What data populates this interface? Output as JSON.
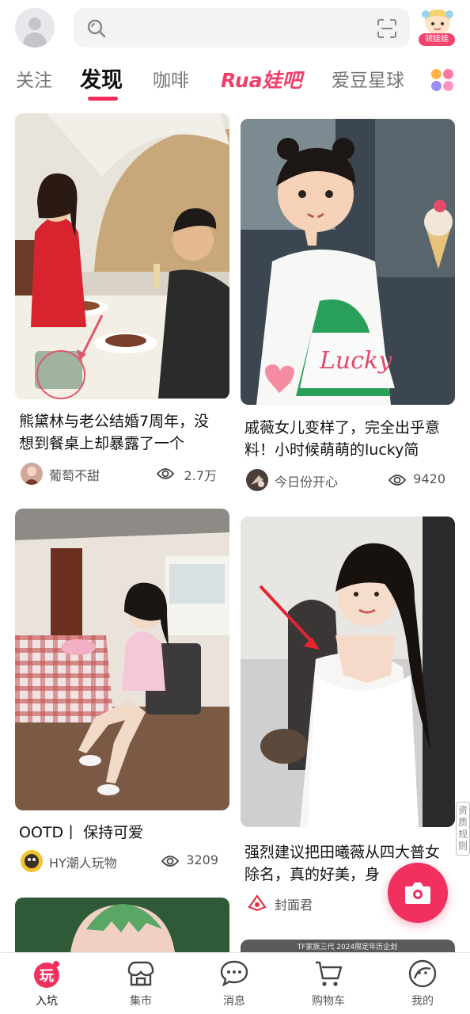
{
  "header": {
    "search_placeholder": "",
    "badge_label": "领娃娃"
  },
  "tabs": [
    "关注",
    "发现",
    "咖啡",
    "Rua娃吧",
    "爱豆星球"
  ],
  "active_tab": "发现",
  "feed": [
    {
      "title": "熊黛林与老公结婚7周年，没想到餐桌上却暴露了一个",
      "author": "葡萄不甜",
      "views": "2.7万"
    },
    {
      "title": "戚薇女儿变样了，完全出乎意料！小时候萌萌的lucky简",
      "author": "今日份开心",
      "views": "9420"
    },
    {
      "title": "OOTD丨 保持可爱",
      "author": "HY潮人玩物",
      "views": "3209"
    },
    {
      "title": "强烈建议把田曦薇从四大普女除名，真的好美，身",
      "author": "封面君",
      "views": ""
    }
  ],
  "side_note": "资质规则",
  "partial_banner_text": "TF家族三代 2024限定年历企划",
  "bottom_nav": [
    {
      "label": "入坑",
      "icon": "play-icon"
    },
    {
      "label": "集市",
      "icon": "market-icon"
    },
    {
      "label": "消息",
      "icon": "chat-icon"
    },
    {
      "label": "购物车",
      "icon": "cart-icon"
    },
    {
      "label": "我的",
      "icon": "profile-icon"
    }
  ],
  "colors": {
    "accent": "#ef2c5c",
    "text": "#111111",
    "muted": "#777777"
  }
}
